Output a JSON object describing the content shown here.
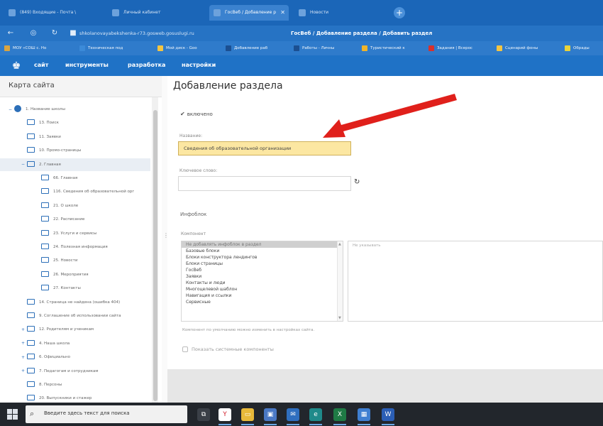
{
  "browser": {
    "tabs": [
      {
        "label": "(849) Входящие - Почта \\",
        "active": false
      },
      {
        "label": "Личный кабинет",
        "active": false
      },
      {
        "label": "ГосВеб / Добавление р",
        "active": true
      },
      {
        "label": "Новости",
        "active": false
      }
    ],
    "new_tab": "+",
    "url": "shkolanovayabekshenka-r73.gosweb.gosuslugi.ru",
    "page_title": "ГосВеб / Добавление раздела / Добавить раздел",
    "bookmarks": [
      {
        "label": "МОУ «СОШ с. Но",
        "color": "#d9a441"
      },
      {
        "label": "Техническая под",
        "color": "#3b8ad8"
      },
      {
        "label": "Мой диск - Goo",
        "color": "#f4c542"
      },
      {
        "label": "Добавление раб",
        "color": "#1b4f91"
      },
      {
        "label": "Работы - Личны",
        "color": "#1b4f91"
      },
      {
        "label": "Туристический к",
        "color": "#f0b429"
      },
      {
        "label": "Задания | Всерос",
        "color": "#d9312c"
      },
      {
        "label": "Сценарий фоны",
        "color": "#f4c542"
      },
      {
        "label": "Обрады",
        "color": "#e9d33a"
      }
    ]
  },
  "appnav": {
    "emblem": "eagle-emblem-icon",
    "items": [
      "сайт",
      "инструменты",
      "разработка",
      "настройки"
    ]
  },
  "sidebar": {
    "title": "Карта сайта",
    "tree": [
      {
        "label": "1. Название школы",
        "toggle": "−",
        "icon": "globe-icon",
        "level": 0
      },
      {
        "label": "13. Поиск",
        "toggle": "",
        "icon": "folder-icon",
        "level": 1
      },
      {
        "label": "11. Заявки",
        "toggle": "",
        "icon": "folder-icon",
        "level": 1
      },
      {
        "label": "10. Промо-страницы",
        "toggle": "",
        "icon": "folder-icon",
        "level": 1
      },
      {
        "label": "2. Главная",
        "toggle": "−",
        "icon": "folder-open-icon",
        "level": 1,
        "selected": true
      },
      {
        "label": "66. Главная",
        "toggle": "",
        "icon": "folder-icon",
        "level": 2
      },
      {
        "label": "116. Сведения об образовательной орг",
        "toggle": "",
        "icon": "folder-icon",
        "level": 2
      },
      {
        "label": "21. О школе",
        "toggle": "",
        "icon": "folder-icon",
        "level": 2
      },
      {
        "label": "22. Расписание",
        "toggle": "",
        "icon": "folder-icon",
        "level": 2
      },
      {
        "label": "23. Услуги и сервисы",
        "toggle": "",
        "icon": "folder-icon",
        "level": 2
      },
      {
        "label": "24. Полезная информация",
        "toggle": "",
        "icon": "folder-icon",
        "level": 2
      },
      {
        "label": "25. Новости",
        "toggle": "",
        "icon": "folder-icon",
        "level": 2
      },
      {
        "label": "26. Мероприятия",
        "toggle": "",
        "icon": "folder-icon",
        "level": 2
      },
      {
        "label": "27. Контакты",
        "toggle": "",
        "icon": "folder-icon",
        "level": 2
      },
      {
        "label": "14. Страница не найдена (ошибка 404)",
        "toggle": "",
        "icon": "folder-icon",
        "level": 1
      },
      {
        "label": "9. Соглашение об использовании сайта",
        "toggle": "",
        "icon": "folder-icon",
        "level": 1
      },
      {
        "label": "12. Родителям и ученикам",
        "toggle": "+",
        "icon": "folder-icon",
        "level": 1
      },
      {
        "label": "4. Наша школа",
        "toggle": "+",
        "icon": "folder-icon",
        "level": 1
      },
      {
        "label": "6. Официально",
        "toggle": "+",
        "icon": "folder-icon",
        "level": 1
      },
      {
        "label": "7. Педагогам и сотрудникам",
        "toggle": "+",
        "icon": "folder-icon",
        "level": 1
      },
      {
        "label": "8. Персоны",
        "toggle": "",
        "icon": "folder-icon",
        "level": 1
      },
      {
        "label": "20. Выпускники и стажер",
        "toggle": "",
        "icon": "folder-icon",
        "level": 1
      }
    ]
  },
  "form": {
    "heading": "Добавление раздела",
    "enabled_label": "включено",
    "name_label": "Название:",
    "name_value": "Сведения об образовательной организации",
    "keywords_label": "Ключевое слово:",
    "keywords_value": "",
    "infoblock_label": "Инфоблок",
    "component_label": "Компонент",
    "components": [
      "Не добавлять инфоблок в раздел",
      "Базовые блоки",
      "Блоки конструктора лендингов",
      "Блоки страницы",
      "ГосВеб",
      "Заявки",
      "Контакты и люди",
      "Многоцелевой шаблон",
      "Навигация и ссылки",
      "Сервисные"
    ],
    "right_box_text": "Не указывать",
    "hint": "Компонент по умолчанию можно изменить в настройках сайта.",
    "system_components_label": "Показать системные компоненты",
    "annotation_color": "#e0201b"
  },
  "taskbar": {
    "search_placeholder": "Введите здесь текст для поиска",
    "apps": [
      {
        "name": "task-view-icon",
        "color": "#3a3f47",
        "glyph": "⧉"
      },
      {
        "name": "yandex-browser-icon",
        "color": "#ffffff",
        "glyph": "Y"
      },
      {
        "name": "file-explorer-icon",
        "color": "#e8b93a",
        "glyph": "▭"
      },
      {
        "name": "store-icon",
        "color": "#4a78c4",
        "glyph": "▣"
      },
      {
        "name": "mail-icon",
        "color": "#2f6fbf",
        "glyph": "✉"
      },
      {
        "name": "edge-icon",
        "color": "#1f8a8a",
        "glyph": "e"
      },
      {
        "name": "excel-icon",
        "color": "#1f7a45",
        "glyph": "X"
      },
      {
        "name": "remote-desktop-icon",
        "color": "#3f7fd1",
        "glyph": "▦"
      },
      {
        "name": "word-icon",
        "color": "#2b5eb5",
        "glyph": "W"
      }
    ]
  }
}
